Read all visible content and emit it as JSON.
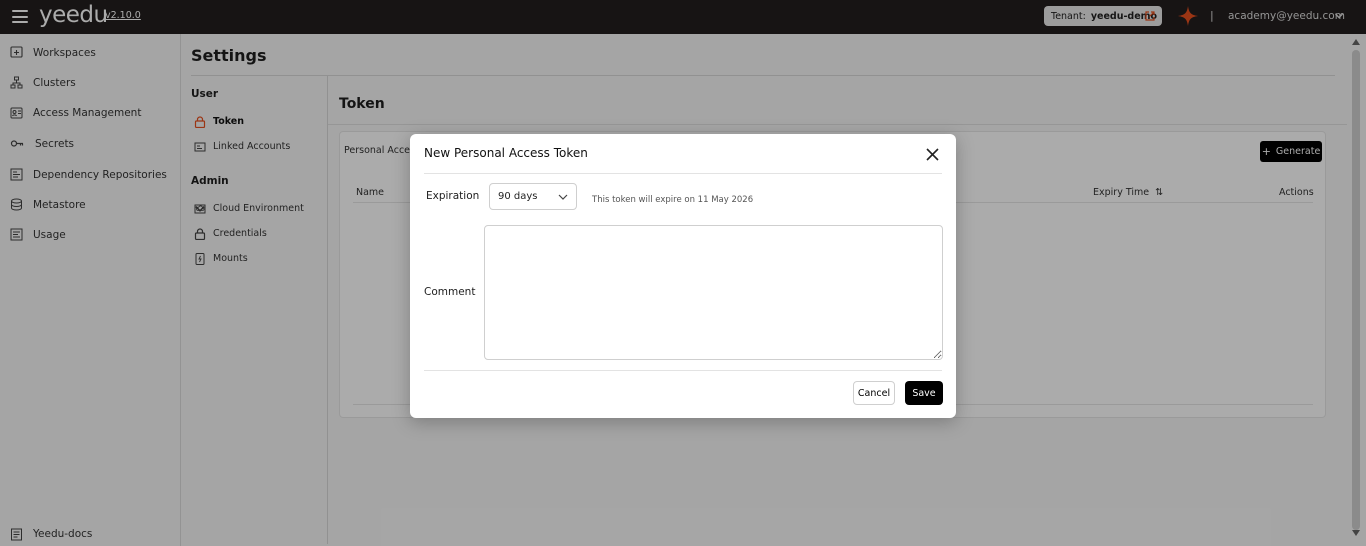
{
  "topbar": {
    "logo": "yeedu",
    "version": "v2.10.0",
    "tenant_label": "Tenant:",
    "tenant_value": "yeedu-demo",
    "account": "academy@yeedu.com",
    "separator": "|"
  },
  "leftnav": {
    "items": [
      {
        "label": "Workspaces",
        "icon": "workspace-icon"
      },
      {
        "label": "Clusters",
        "icon": "cluster-icon"
      },
      {
        "label": "Access Management",
        "icon": "id-badge-icon"
      },
      {
        "label": "Secrets",
        "icon": "key-icon"
      },
      {
        "label": "Dependency Repositories",
        "icon": "repository-icon"
      },
      {
        "label": "Metastore",
        "icon": "database-icon"
      },
      {
        "label": "Usage",
        "icon": "usage-icon"
      }
    ],
    "docs_label": "Yeedu-docs"
  },
  "settings": {
    "title": "Settings",
    "user_group": "User",
    "admin_group": "Admin",
    "user_items": [
      {
        "label": "Token",
        "icon": "lock-icon",
        "active": true
      },
      {
        "label": "Linked Accounts",
        "icon": "link-accounts-icon",
        "active": false
      }
    ],
    "admin_items": [
      {
        "label": "Cloud Environment",
        "icon": "cloud-env-icon"
      },
      {
        "label": "Credentials",
        "icon": "lock-icon"
      },
      {
        "label": "Mounts",
        "icon": "mount-icon"
      }
    ]
  },
  "content": {
    "title": "Token",
    "card_subtitle": "Personal Access",
    "generate_label": "Generate",
    "columns": {
      "name": "Name",
      "expiry": "Expiry Time",
      "sort": "⇅",
      "actions": "Actions"
    }
  },
  "modal": {
    "title": "New Personal Access Token",
    "expiration_label": "Expiration",
    "expiration_value": "90 days",
    "expiry_note": "This token will expire on 11 May 2026",
    "comment_label": "Comment",
    "comment_value": "",
    "cancel_label": "Cancel",
    "save_label": "Save"
  },
  "colors": {
    "topbar": "#231f1e",
    "accent": "#e8501f",
    "primary_button": "#000000"
  }
}
